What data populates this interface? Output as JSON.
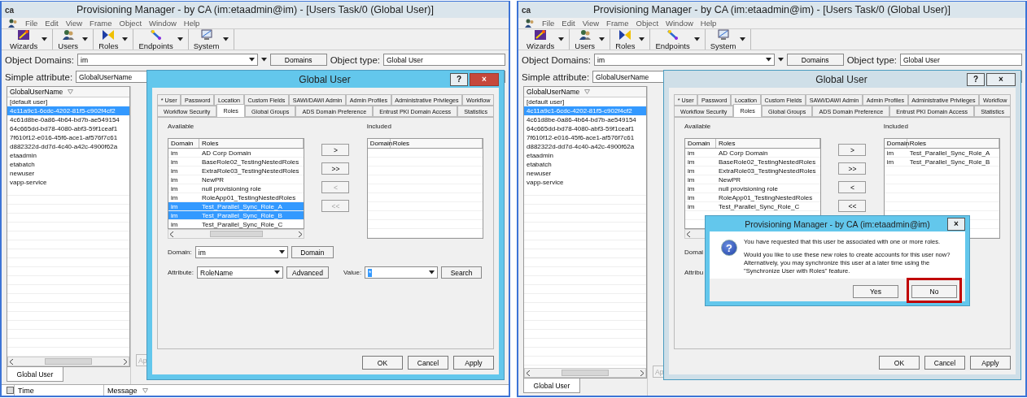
{
  "panels": [
    {
      "window": {
        "logo": "ca",
        "title": "Provisioning Manager - by CA (im:etaadmin@im) - [Users Task/0 (Global User)]"
      },
      "menu": [
        "File",
        "Edit",
        "View",
        "Frame",
        "Object",
        "Window",
        "Help"
      ],
      "toolbar": [
        {
          "label": "Wizards",
          "kind": "wizards"
        },
        {
          "label": "Users",
          "kind": "users"
        },
        {
          "label": "Roles",
          "kind": "roles"
        },
        {
          "label": "Endpoints",
          "kind": "endpoints"
        },
        {
          "label": "System",
          "kind": "system"
        }
      ],
      "object_domains": {
        "label": "Object Domains:",
        "value": "im",
        "button": "Domains"
      },
      "object_type": {
        "label": "Object type:",
        "value": "Global User"
      },
      "simple_attribute": {
        "label": "Simple attribute:",
        "value": "GlobalUserName"
      },
      "user_list": {
        "column": "GlobalUserName",
        "rows": [
          {
            "text": "[default user]",
            "selected": false
          },
          {
            "text": "4c11a9c1-6cdc-4202-81f5-c902f4cf2",
            "selected": true
          },
          {
            "text": "4c61d8be-0a86-4b64-bd7b-ae549154",
            "selected": false
          },
          {
            "text": "64c665dd-bd78-4080-abf3-59f1ceaf1",
            "selected": false
          },
          {
            "text": "7f610f12-e016-45f6-ace1-af576f7c61",
            "selected": false
          },
          {
            "text": "d882322d-dd7d-4c40-a42c-4900f62a",
            "selected": false
          },
          {
            "text": "etaadmin",
            "selected": false
          },
          {
            "text": "etabatch",
            "selected": false
          },
          {
            "text": "newuser",
            "selected": false
          },
          {
            "text": "vapp-service",
            "selected": false
          }
        ]
      },
      "bottom_tab": "Global User",
      "hidden_button": "Ap",
      "status_bar": {
        "columns": [
          "Time",
          "Message"
        ]
      },
      "dialog": {
        "title": "Global User",
        "active": true,
        "help_button": "?",
        "close_button": "×",
        "tab_rows": [
          [
            {
              "label": "* User",
              "selected": false
            },
            {
              "label": "Password",
              "selected": false
            },
            {
              "label": "Location",
              "selected": false
            },
            {
              "label": "Custom Fields",
              "selected": false
            },
            {
              "label": "SAWI/DAWI Admin",
              "selected": false
            },
            {
              "label": "Admin Profiles",
              "selected": false
            },
            {
              "label": "Administrative Privileges",
              "selected": false
            },
            {
              "label": "Workflow",
              "selected": false
            }
          ],
          [
            {
              "label": "Workflow Security",
              "selected": false
            },
            {
              "label": "Roles",
              "selected": true
            },
            {
              "label": "Global Groups",
              "selected": false
            },
            {
              "label": "ADS Domain Preference",
              "selected": false
            },
            {
              "label": "Entrust PKI Domain Access",
              "selected": false
            },
            {
              "label": "Statistics",
              "selected": false
            }
          ]
        ],
        "available": {
          "label": "Available",
          "columns": [
            "Domain",
            "Roles"
          ],
          "rows": [
            {
              "domain": "im",
              "role": "AD Corp Domain",
              "selected": false
            },
            {
              "domain": "im",
              "role": "BaseRole02_TestingNestedRoles",
              "selected": false
            },
            {
              "domain": "im",
              "role": "ExtraRole03_TestingNestedRoles",
              "selected": false
            },
            {
              "domain": "im",
              "role": "NewPR",
              "selected": false
            },
            {
              "domain": "im",
              "role": "null provisioning role",
              "selected": false
            },
            {
              "domain": "im",
              "role": "RoleApp01_TestingNestedRoles",
              "selected": false
            },
            {
              "domain": "im",
              "role": "Test_Parallel_Sync_Role_A",
              "selected": true
            },
            {
              "domain": "im",
              "role": "Test_Parallel_Sync_Role_B",
              "selected": true
            },
            {
              "domain": "im",
              "role": "Test_Parallel_Sync_Role_C",
              "selected": false
            }
          ]
        },
        "move_buttons": [
          {
            "label": ">",
            "disabled": false
          },
          {
            "label": ">>",
            "disabled": false
          },
          {
            "label": "<",
            "disabled": true
          },
          {
            "label": "<<",
            "disabled": true
          }
        ],
        "included": {
          "label": "Included",
          "columns": [
            "Domain",
            "Roles"
          ]
        },
        "domain_row": {
          "label": "Domain:",
          "value": "im",
          "button": "Domain"
        },
        "attribute_row": {
          "label": "Attribute:",
          "value": "RoleName",
          "button": "Advanced",
          "value_label": "Value:",
          "value_field": "*",
          "search_button": "Search"
        },
        "footer_buttons": [
          "OK",
          "Cancel",
          "Apply"
        ]
      }
    },
    {
      "window": {
        "logo": "ca",
        "title": "Provisioning Manager - by CA (im:etaadmin@im) - [Users Task/0 (Global User)]"
      },
      "menu": [
        "File",
        "Edit",
        "View",
        "Frame",
        "Object",
        "Window",
        "Help"
      ],
      "toolbar": [
        {
          "label": "Wizards",
          "kind": "wizards"
        },
        {
          "label": "Users",
          "kind": "users"
        },
        {
          "label": "Roles",
          "kind": "roles"
        },
        {
          "label": "Endpoints",
          "kind": "endpoints"
        },
        {
          "label": "System",
          "kind": "system"
        }
      ],
      "object_domains": {
        "label": "Object Domains:",
        "value": "im",
        "button": "Domains"
      },
      "object_type": {
        "label": "Object type:",
        "value": "Global User"
      },
      "simple_attribute": {
        "label": "Simple attribute:",
        "value": "GlobalUserName"
      },
      "user_list": {
        "column": "GlobalUserName",
        "rows": [
          {
            "text": "[default user]",
            "selected": false
          },
          {
            "text": "4c11a9c1-6cdc-4202-81f5-c902f4cf2",
            "selected": true
          },
          {
            "text": "4c61d8be-0a86-4b64-bd7b-ae549154",
            "selected": false
          },
          {
            "text": "64c665dd-bd78-4080-abf3-59f1ceaf1",
            "selected": false
          },
          {
            "text": "7f610f12-e016-45f6-ace1-af576f7c61",
            "selected": false
          },
          {
            "text": "d882322d-dd7d-4c40-a42c-4900f62a",
            "selected": false
          },
          {
            "text": "etaadmin",
            "selected": false
          },
          {
            "text": "etabatch",
            "selected": false
          },
          {
            "text": "newuser",
            "selected": false
          },
          {
            "text": "vapp-service",
            "selected": false
          }
        ]
      },
      "bottom_tab": "Global User",
      "hidden_button": "Ap",
      "dialog": {
        "title": "Global User",
        "active": false,
        "help_button": "?",
        "close_button": "×",
        "tab_rows": [
          [
            {
              "label": "* User",
              "selected": false
            },
            {
              "label": "Password",
              "selected": false
            },
            {
              "label": "Location",
              "selected": false
            },
            {
              "label": "Custom Fields",
              "selected": false
            },
            {
              "label": "SAWI/DAWI Admin",
              "selected": false
            },
            {
              "label": "Admin Profiles",
              "selected": false
            },
            {
              "label": "Administrative Privileges",
              "selected": false
            },
            {
              "label": "Workflow",
              "selected": false
            }
          ],
          [
            {
              "label": "Workflow Security",
              "selected": false
            },
            {
              "label": "Roles",
              "selected": true
            },
            {
              "label": "Global Groups",
              "selected": false
            },
            {
              "label": "ADS Domain Preference",
              "selected": false
            },
            {
              "label": "Entrust PKI Domain Access",
              "selected": false
            },
            {
              "label": "Statistics",
              "selected": false
            }
          ]
        ],
        "available": {
          "label": "Available",
          "columns": [
            "Domain",
            "Roles"
          ],
          "rows": [
            {
              "domain": "im",
              "role": "AD Corp Domain",
              "selected": false
            },
            {
              "domain": "im",
              "role": "BaseRole02_TestingNestedRoles",
              "selected": false
            },
            {
              "domain": "im",
              "role": "ExtraRole03_TestingNestedRoles",
              "selected": false
            },
            {
              "domain": "im",
              "role": "NewPR",
              "selected": false
            },
            {
              "domain": "im",
              "role": "null provisioning role",
              "selected": false
            },
            {
              "domain": "im",
              "role": "RoleApp01_TestingNestedRoles",
              "selected": false
            },
            {
              "domain": "im",
              "role": "Test_Parallel_Sync_Role_C",
              "selected": false
            }
          ]
        },
        "move_buttons": [
          {
            "label": ">",
            "disabled": false
          },
          {
            "label": ">>",
            "disabled": false
          },
          {
            "label": "<",
            "disabled": false
          },
          {
            "label": "<<",
            "disabled": false
          }
        ],
        "included": {
          "label": "Included",
          "columns": [
            "Domain",
            "Roles"
          ],
          "rows": [
            {
              "domain": "im",
              "role": "Test_Parallel_Sync_Role_A",
              "selected": false
            },
            {
              "domain": "im",
              "role": "Test_Parallel_Sync_Role_B",
              "selected": false
            }
          ]
        },
        "domain_row": {
          "label": "Domai"
        },
        "attribute_row": {
          "label": "Attribu"
        },
        "footer_buttons": [
          "OK",
          "Cancel",
          "Apply"
        ]
      },
      "message_box": {
        "title": "Provisioning Manager - by CA (im:etaadmin@im)",
        "close_button": "×",
        "icon": "?",
        "paragraphs": [
          "You have requested that this user be associated with one or more roles.",
          "Would you like to use these new roles to create accounts for this user now?  Alternatively, you may synchronize this user at a later time using the \"Synchronize User with Roles\" feature."
        ],
        "buttons": [
          {
            "label": "Yes",
            "highlighted": false
          },
          {
            "label": "No",
            "highlighted": true
          }
        ]
      }
    }
  ]
}
